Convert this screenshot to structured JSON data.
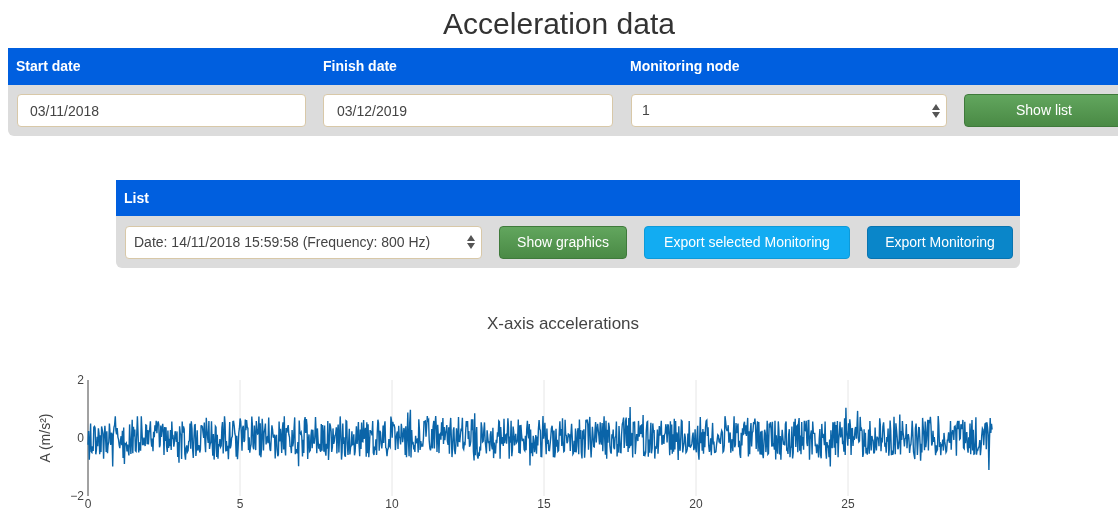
{
  "title": "Acceleration data",
  "filters": {
    "labels": [
      "Start date",
      "Finish date",
      "Monitoring node"
    ],
    "start_date": "03/11/2018",
    "finish_date": "03/12/2019",
    "node": "1",
    "button": "Show list"
  },
  "list": {
    "header": "List",
    "selected_item": "Date: 14/11/2018 15:59:58 (Frequency: 800 Hz)",
    "buttons": [
      {
        "label": "Show graphics",
        "kind": "success"
      },
      {
        "label": "Export selected Monitoring",
        "kind": "info"
      },
      {
        "label": "Export Monitoring",
        "kind": "primary"
      }
    ]
  },
  "chart": {
    "title": "X-axis accelerations",
    "ylabel": "A (m/s²)",
    "yticks": [
      "2",
      "0",
      "−2"
    ],
    "xticks": [
      "0",
      "5",
      "10",
      "15",
      "20",
      "25"
    ]
  }
}
